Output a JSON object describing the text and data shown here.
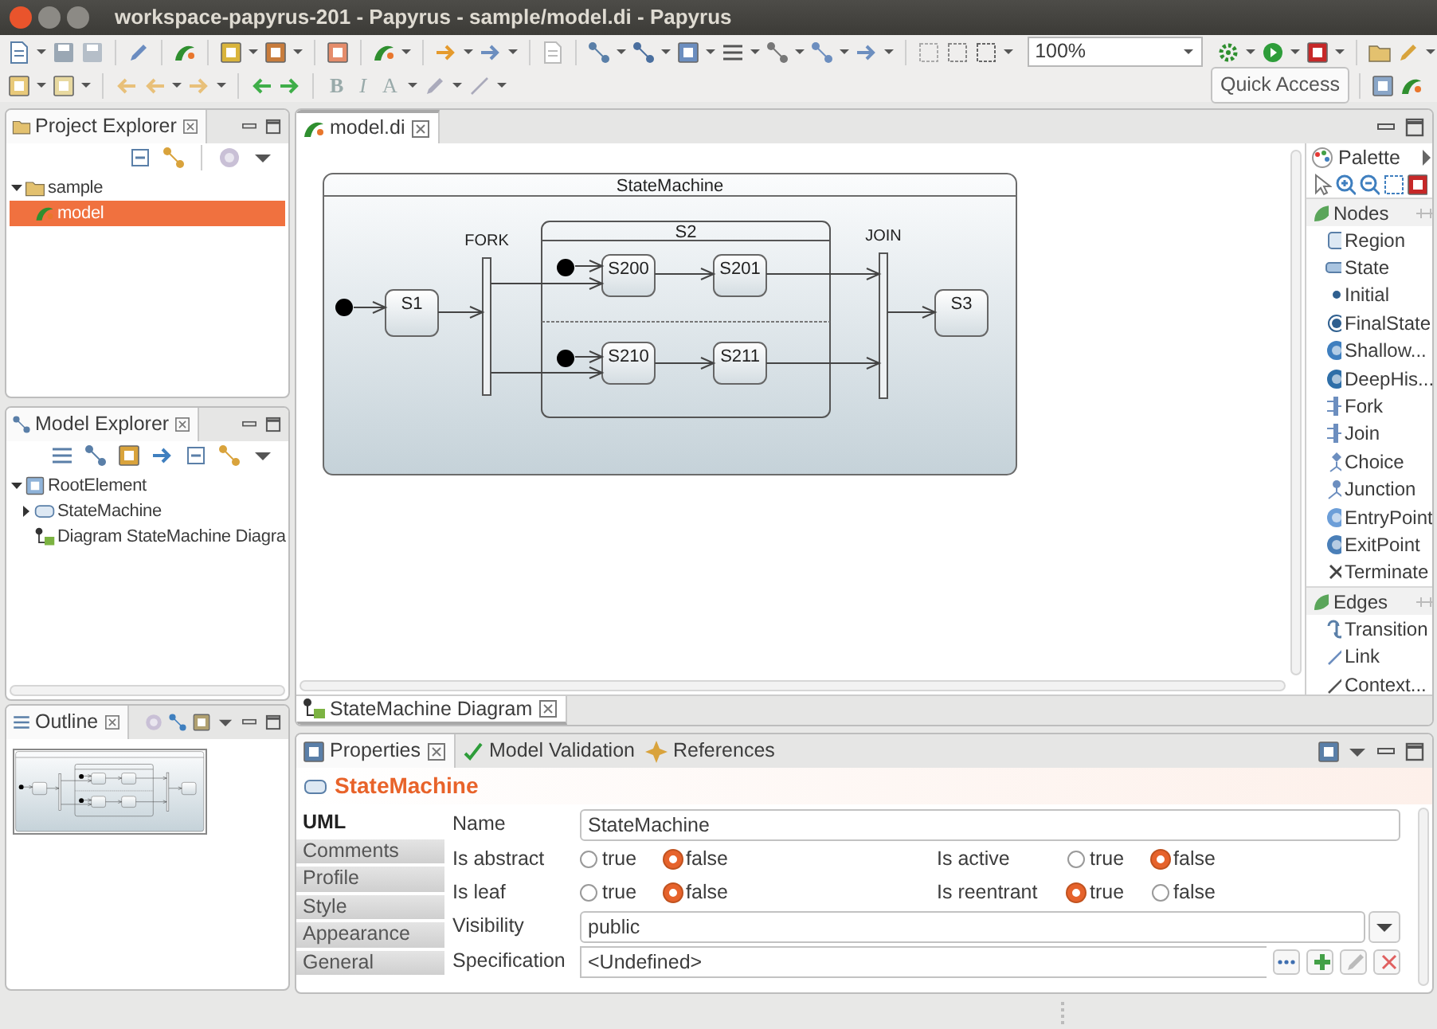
{
  "window": {
    "title": "workspace-papyrus-201 - Papyrus - sample/model.di - Papyrus"
  },
  "toolbar": {
    "zoom": "100%",
    "text_buttons": [
      "B",
      "I",
      "A"
    ],
    "quick_access": "Quick Access"
  },
  "project_explorer": {
    "title": "Project Explorer",
    "tree": [
      {
        "label": "sample",
        "kind": "folder",
        "selected": false,
        "expanded": true,
        "children": [
          {
            "label": "model",
            "kind": "model",
            "selected": true
          }
        ]
      }
    ]
  },
  "model_explorer": {
    "title": "Model Explorer",
    "tree": [
      {
        "label": "RootElement",
        "kind": "package",
        "selected": false,
        "expanded": true,
        "children": [
          {
            "label": "StateMachine",
            "kind": "statemachine",
            "selected": false,
            "expanded": false
          },
          {
            "label": "Diagram StateMachine Diagra",
            "kind": "diagram",
            "selected": false
          }
        ]
      }
    ]
  },
  "outline": {
    "title": "Outline"
  },
  "editor": {
    "tabs": [
      {
        "label": "model.di",
        "selected": true
      }
    ],
    "diagram": {
      "title": "StateMachine",
      "elements": [
        {
          "kind": "initial"
        },
        {
          "kind": "state",
          "label": "S1"
        },
        {
          "kind": "fork",
          "label": "FORK"
        },
        {
          "kind": "composite",
          "label": "S2"
        },
        {
          "kind": "initial"
        },
        {
          "kind": "state",
          "label": "S200"
        },
        {
          "kind": "state",
          "label": "S201"
        },
        {
          "kind": "initial"
        },
        {
          "kind": "state",
          "label": "S210"
        },
        {
          "kind": "state",
          "label": "S211"
        },
        {
          "kind": "join",
          "label": "JOIN"
        },
        {
          "kind": "state",
          "label": "S3"
        }
      ]
    },
    "palette": {
      "title": "Palette",
      "groups": [
        {
          "label": "Nodes",
          "items": [
            "Region",
            "State",
            "Initial",
            "FinalState",
            "Shallow...",
            "DeepHis...",
            "Fork",
            "Join",
            "Choice",
            "Junction",
            "EntryPoint",
            "ExitPoint",
            "Terminate"
          ]
        },
        {
          "label": "Edges",
          "items": [
            "Transition",
            "Link",
            "Context..."
          ]
        }
      ]
    },
    "diagram_tabs": [
      {
        "label": "StateMachine Diagram",
        "selected": true
      }
    ]
  },
  "properties": {
    "tabs": [
      {
        "label": "Properties",
        "selected": true
      },
      {
        "label": "Model Validation",
        "selected": false
      },
      {
        "label": "References",
        "selected": false
      }
    ],
    "element": "StateMachine",
    "sections": [
      {
        "label": "UML",
        "selected": true
      },
      {
        "label": "Comments",
        "selected": false
      },
      {
        "label": "Profile",
        "selected": false
      },
      {
        "label": "Style",
        "selected": false
      },
      {
        "label": "Appearance",
        "selected": false
      },
      {
        "label": "General",
        "selected": false
      }
    ],
    "name": {
      "label": "Name",
      "value": "StateMachine"
    },
    "booleans": [
      {
        "label": "Is abstract",
        "options": [
          {
            "label": "true",
            "selected": false
          },
          {
            "label": "false",
            "selected": true
          }
        ]
      },
      {
        "label": "Is active",
        "options": [
          {
            "label": "true",
            "selected": false
          },
          {
            "label": "false",
            "selected": true
          }
        ]
      },
      {
        "label": "Is leaf",
        "options": [
          {
            "label": "true",
            "selected": false
          },
          {
            "label": "false",
            "selected": true
          }
        ]
      },
      {
        "label": "Is reentrant",
        "options": [
          {
            "label": "true",
            "selected": true
          },
          {
            "label": "false",
            "selected": false
          }
        ]
      }
    ],
    "visibility": {
      "label": "Visibility",
      "value": "public"
    },
    "specification": {
      "label": "Specification",
      "value": "<Undefined>"
    }
  }
}
